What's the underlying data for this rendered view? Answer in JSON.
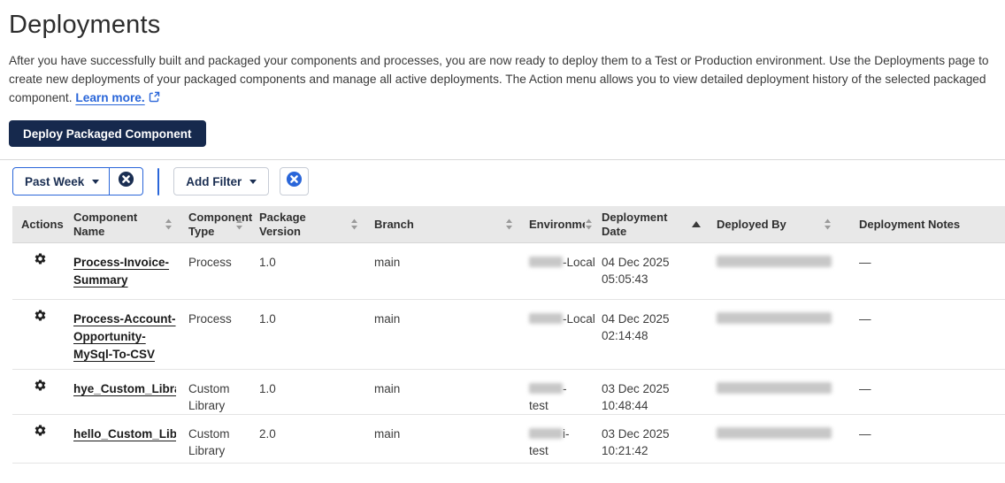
{
  "page": {
    "title": "Deployments",
    "description": "After you have successfully built and packaged your components and processes, you are now ready to deploy them to a Test or Production environment. Use the Deployments page to create new deployments of your packaged components and manage all active deployments. The Action menu allows you to view detailed deployment history of the selected packaged component.",
    "learn_more_label": "Learn more.",
    "deploy_button_label": "Deploy Packaged Component"
  },
  "filters": {
    "date_filter_label": "Past Week",
    "add_filter_label": "Add Filter"
  },
  "table": {
    "sort": {
      "column": "Deployment Date",
      "direction": "ascending"
    },
    "columns": [
      {
        "key": "actions",
        "label": "Actions",
        "sort": "none"
      },
      {
        "key": "name",
        "label": "Component Name",
        "sort": "both"
      },
      {
        "key": "type",
        "label": "Component Type",
        "sort": "both"
      },
      {
        "key": "version",
        "label": "Package Version",
        "sort": "both"
      },
      {
        "key": "branch",
        "label": "Branch",
        "sort": "both"
      },
      {
        "key": "env",
        "label": "Environment",
        "sort": "both"
      },
      {
        "key": "date",
        "label": "Deployment Date",
        "sort": "asc"
      },
      {
        "key": "by",
        "label": "Deployed By",
        "sort": "both"
      },
      {
        "key": "notes",
        "label": "Deployment Notes",
        "sort": "none"
      }
    ],
    "rows": [
      {
        "component_name": "Process-Invoice-Summary",
        "name_clipped": false,
        "component_type": "Process",
        "package_version": "1.0",
        "branch": "main",
        "environment": {
          "redacted": true,
          "suffix": "-Local",
          "line2": ""
        },
        "deployment_date": "04 Dec 2025",
        "deployment_time": "05:05:43",
        "deployed_by_redacted": true,
        "deployment_notes": "—"
      },
      {
        "component_name": "Process-Account-Opportunity-MySql-To-CSV",
        "name_clipped": false,
        "component_type": "Process",
        "package_version": "1.0",
        "branch": "main",
        "environment": {
          "redacted": true,
          "suffix": "-Local",
          "line2": ""
        },
        "deployment_date": "04 Dec 2025",
        "deployment_time": "02:14:48",
        "deployed_by_redacted": true,
        "deployment_notes": "—"
      },
      {
        "component_name": "hye_Custom_Library",
        "name_clipped": true,
        "component_type": "Custom Library",
        "package_version": "1.0",
        "branch": "main",
        "environment": {
          "redacted": true,
          "suffix": "-",
          "line2": "test"
        },
        "deployment_date": "03 Dec 2025",
        "deployment_time": "10:48:44",
        "deployed_by_redacted": true,
        "deployment_notes": "—"
      },
      {
        "component_name": "hello_Custom_Library",
        "name_clipped": true,
        "component_type": "Custom Library",
        "package_version": "2.0",
        "branch": "main",
        "environment": {
          "redacted": true,
          "suffix": "i-",
          "line2": "test"
        },
        "deployment_date": "03 Dec 2025",
        "deployment_time": "10:21:42",
        "deployed_by_redacted": true,
        "deployment_notes": "—"
      }
    ]
  },
  "colors": {
    "accent_blue": "#2a66d9",
    "navy": "#1a2e52",
    "button_navy": "#16294d",
    "header_bg": "#e8e8e8"
  }
}
